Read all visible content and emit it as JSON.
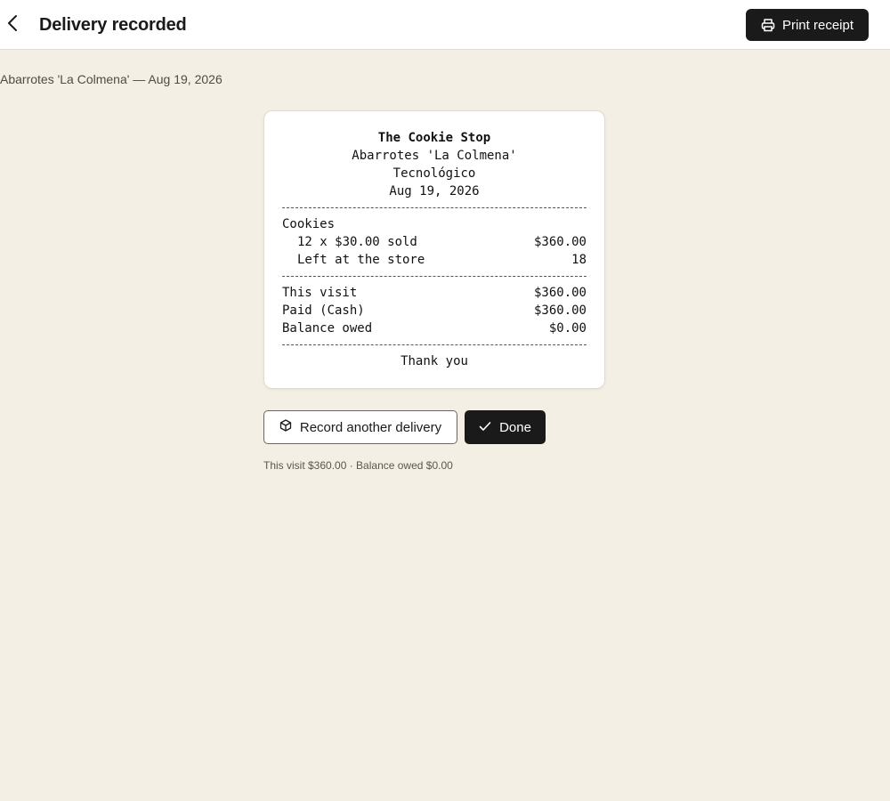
{
  "header": {
    "title": "Delivery recorded",
    "back_icon": "chevron-left-icon",
    "print_label": "Print receipt",
    "print_icon": "printer-icon"
  },
  "subtitle": "Abarrotes 'La Colmena' — Aug 19, 2026",
  "receipt": {
    "business": "The Cookie Stop",
    "store": "Abarrotes 'La Colmena'",
    "area": "Tecnológico",
    "date": "Aug 19, 2026",
    "product": "Cookies",
    "sold_label": "12 x $30.00 sold",
    "sold_amount": "$360.00",
    "left_label": "Left at the store",
    "left_value": "18",
    "visit_label": "This visit",
    "visit_amount": "$360.00",
    "paid_label": "Paid (Cash)",
    "paid_amount": "$360.00",
    "balance_label": "Balance owed",
    "balance_amount": "$0.00",
    "footer": "Thank you"
  },
  "actions": {
    "record_another_label": "Record another delivery",
    "record_another_icon": "box-icon",
    "done_label": "Done",
    "done_icon": "check-icon"
  },
  "summary": "This visit $360.00 · Balance owed $0.00",
  "colors": {
    "background": "#f3efe4",
    "primary_button": "#1a1a1a",
    "surface": "#ffffff"
  }
}
